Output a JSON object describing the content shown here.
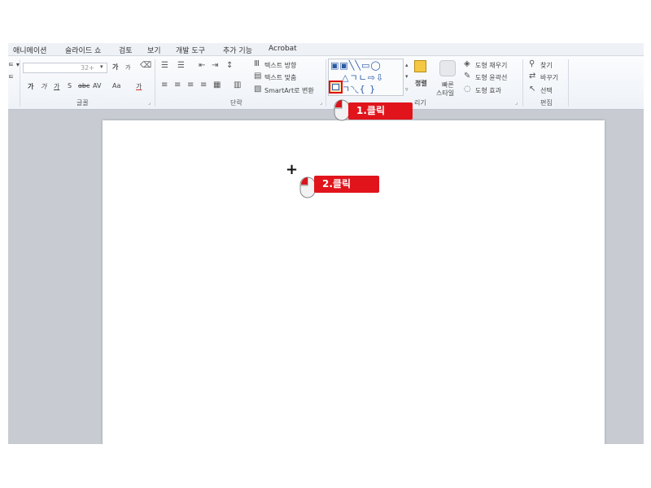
{
  "menu": {
    "tabs": [
      "애니메이션",
      "슬라이드 쇼",
      "검토",
      "보기",
      "개발 도구",
      "추가 기능",
      "Acrobat"
    ]
  },
  "ribbon": {
    "left_stub": [
      "ㅌ ▾",
      "ㅌ"
    ],
    "font": {
      "size_value": "32+",
      "grow_label": "가",
      "shrink_label": "가",
      "bold_label": "가",
      "italic_label": "가",
      "underline_label": "가",
      "strike_label": "S",
      "abc_label": "abc",
      "spacing_label": "AV",
      "case_label": "Aa",
      "color_label": "가",
      "group_label": "글꼴"
    },
    "paragraph": {
      "text_direction": "텍스트 방향",
      "align_text": "텍스트 맞춤",
      "smartart": "SmartArt로 변환",
      "group_label": "단락"
    },
    "drawing": {
      "arrange_label": "정렬",
      "quick_styles_label_1": "빠른",
      "quick_styles_label_2": "스타일",
      "shape_fill": "도형 채우기",
      "shape_outline": "도형 윤곽선",
      "shape_effects": "도형 효과",
      "group_label_partial": "리기"
    },
    "editing": {
      "find": "찾기",
      "replace": "바꾸기",
      "select": "선택",
      "group_label": "편집"
    }
  },
  "callouts": {
    "step1": "1.클릭",
    "step2": "2.클릭"
  },
  "colors": {
    "callout": "#e1141c",
    "highlight_border": "#e01010",
    "ribbon_bg": "#eef2f7",
    "workspace_bg": "#c8ccd2"
  }
}
